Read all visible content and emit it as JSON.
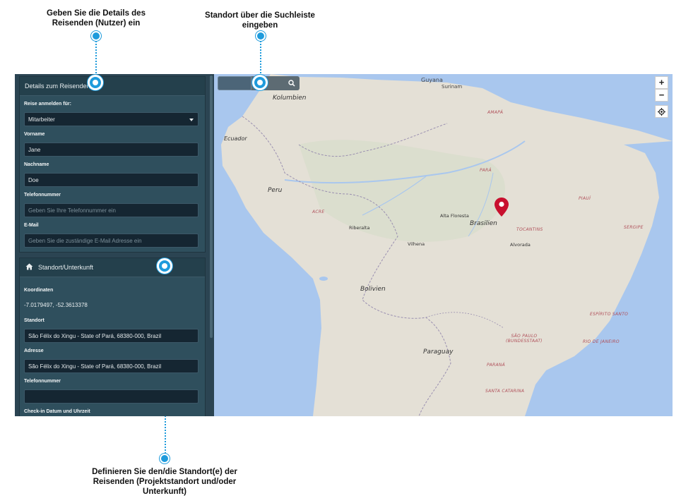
{
  "callouts": {
    "details": "Geben Sie die Details des\nReisenden (Nutzer) ein",
    "search": "Standort über die Suchleiste\neingeben",
    "location": "Definieren Sie den/die Standort(e) der\nReisenden (Projektstandort und/oder\nUnterkunft)"
  },
  "traveler_panel": {
    "title": "Details zum Reisenden",
    "register_for_label": "Reise anmelden für:",
    "register_for_value": "Mitarbeiter",
    "first_name_label": "Vorname",
    "first_name_value": "Jane",
    "last_name_label": "Nachname",
    "last_name_value": "Doe",
    "phone_label": "Telefonnummer",
    "phone_placeholder": "Geben Sie Ihre Telefonnummer ein",
    "email_label": "E-Mail",
    "email_placeholder": "Geben Sie die zuständige E-Mail Adresse ein"
  },
  "location_panel": {
    "title": "Standort/Unterkunft",
    "coords_label": "Koordinaten",
    "coords_value": "-7.0179497, -52.3613378",
    "location_label": "Standort",
    "location_value": "São Félix do Xingu - State of Pará, 68380-000, Brazil",
    "address_label": "Adresse",
    "address_value": "São Félix do Xingu - State of Pará, 68380-000, Brazil",
    "phone_label": "Telefonnummer",
    "checkin_label": "Check-in Datum und Uhrzeit"
  },
  "map": {
    "zoom_in": "+",
    "zoom_out": "−",
    "labels": {
      "guyana": "Guyana",
      "suriname": "Surinam",
      "kolumbien": "Kolumbien",
      "ecuador": "Ecuador",
      "peru": "Peru",
      "bolivien": "Bolivien",
      "paraguay": "Paraguay",
      "brasilien": "Brasilien",
      "amapa": "AMAPÁ",
      "para": "PARÁ",
      "acre": "ACRE",
      "piaui": "PIAUÍ",
      "tocantins": "TOCANTINS",
      "sergipe": "SERGIPE",
      "espirito_santo": "ESPÍRITO SANTO",
      "sao_paulo": "SÃO PAULO\n(BUNDESSTAAT)",
      "rio": "RIO DE JANEIRO",
      "parana": "PARANÁ",
      "santa_catarina": "SANTA CATARINA",
      "alta_floresta": "Alta Floresta",
      "riberalta": "Riberalta",
      "vilhena": "Vilhena",
      "alvorada": "Alvorada"
    }
  },
  "colors": {
    "accent": "#1e9bdc",
    "marker": "#c8102e",
    "sidebar": "#2b4452",
    "ocean": "#a9c7ee",
    "land": "#e4e0d6"
  }
}
